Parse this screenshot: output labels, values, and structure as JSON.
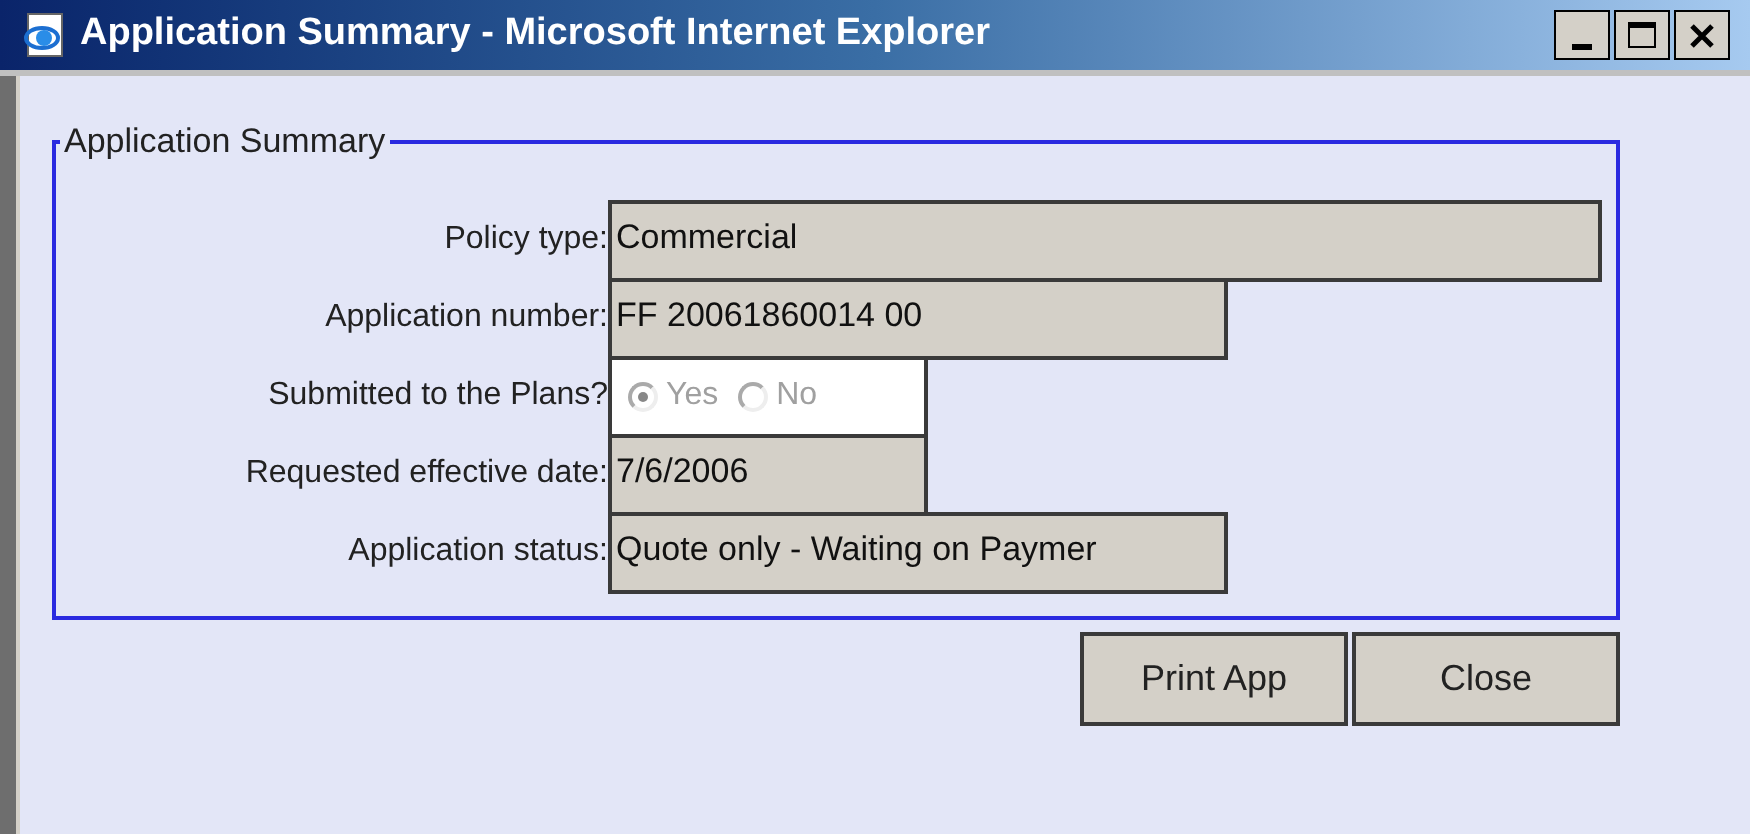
{
  "window": {
    "title": "Application Summary - Microsoft Internet Explorer"
  },
  "fieldset": {
    "legend": "Application Summary"
  },
  "rows": [
    {
      "kind": "field",
      "label": "Policy type:",
      "value": "Commercial"
    },
    {
      "kind": "field",
      "label": "Application number:",
      "value": "FF 20061860014 00"
    },
    {
      "kind": "radio",
      "label": "Submitted to the Plans?",
      "disabled": true,
      "options": [
        {
          "label": "Yes",
          "selected": true
        },
        {
          "label": "No",
          "selected": false
        }
      ]
    },
    {
      "kind": "field",
      "label": "Requested effective date:",
      "value": "7/6/2006"
    },
    {
      "kind": "field",
      "label": "Application status:",
      "value": "Quote only - Waiting on Paymer"
    }
  ],
  "buttons": [
    "Print App",
    "Close"
  ]
}
